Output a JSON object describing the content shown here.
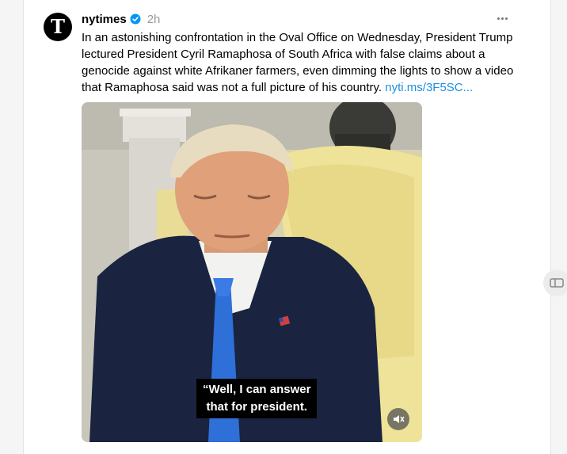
{
  "post": {
    "username": "nytimes",
    "time": "2h",
    "text": "In an astonishing confrontation in the Oval Office on Wednesday, President Trump lectured President Cyril Ramaphosa of South Africa with false claims about a genocide against white Afrikaner farmers, even dimming the lights to show a video that Ramaphosa said was not a full picture of his country. ",
    "link": "nyti.ms/3F5SC...",
    "caption_line1": "“Well, I can answer",
    "caption_line2": "that for president."
  },
  "icons": {
    "avatar": "nytimes-logo-icon",
    "verified": "verified-badge-icon",
    "more": "more-options-icon",
    "mute": "muted-speaker-icon",
    "side": "side-panel-icon"
  },
  "colors": {
    "link": "#1d8fe0",
    "verified": "#0095f6"
  }
}
